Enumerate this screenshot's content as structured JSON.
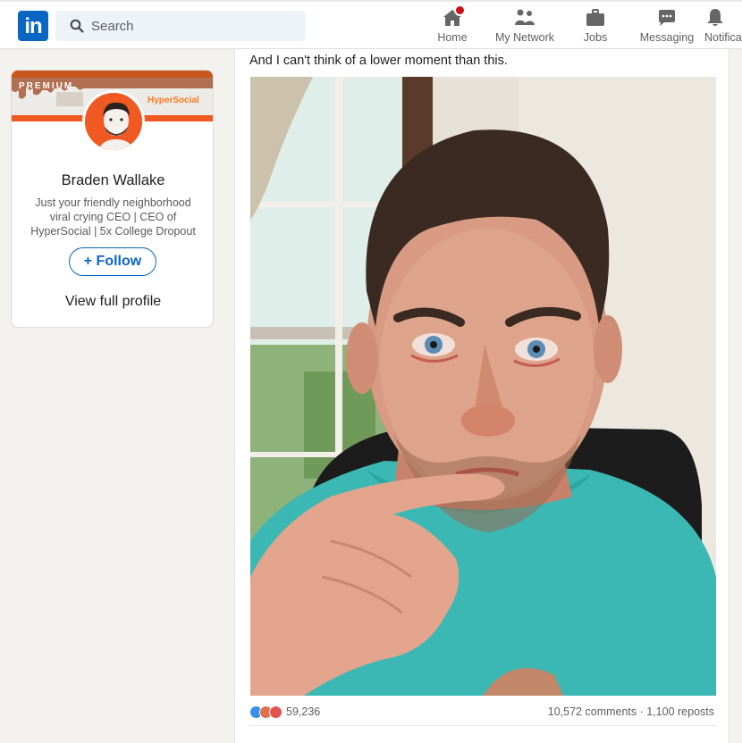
{
  "nav": {
    "search_placeholder": "Search",
    "items": [
      {
        "label": "Home",
        "icon": "home-icon"
      },
      {
        "label": "My Network",
        "icon": "network-icon"
      },
      {
        "label": "Jobs",
        "icon": "jobs-icon"
      },
      {
        "label": "Messaging",
        "icon": "messaging-icon"
      },
      {
        "label": "Notifications",
        "icon": "bell-icon"
      }
    ],
    "brand_color": "#0a66c2"
  },
  "profile": {
    "banner_badge": "PREMIUM",
    "banner_logo": "HyperSocial",
    "name": "Braden Wallake",
    "headline": "Just your friendly neighborhood viral crying CEO | CEO of HyperSocial | 5x College Dropout",
    "follow_label": "+ Follow",
    "view_profile_label": "View full profile"
  },
  "post": {
    "text": "And I can't think of a lower moment than this.",
    "photo_description_icon": "photo-crying-man",
    "reaction_count": "59,236",
    "comments_reposts": "10,572 comments · 1,100 reposts"
  }
}
